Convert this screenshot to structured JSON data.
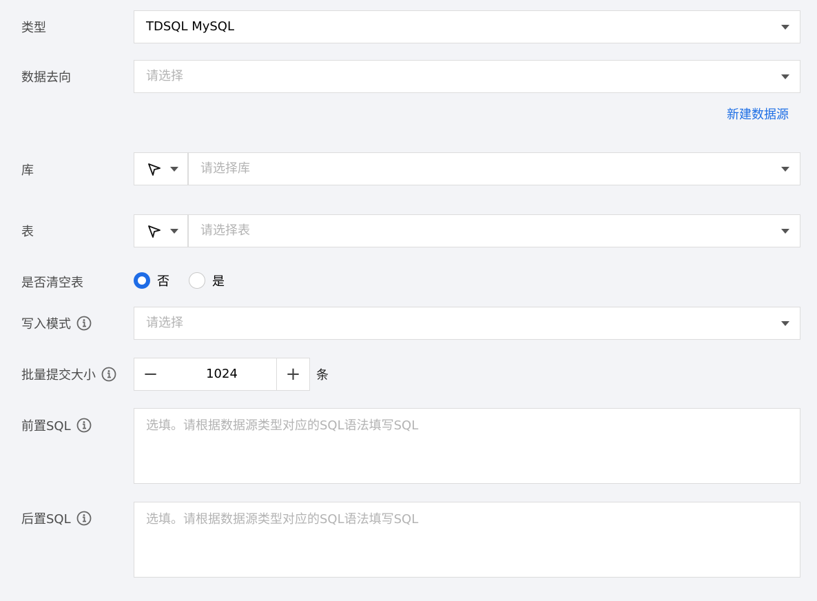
{
  "fields": {
    "type": {
      "label": "类型",
      "value": "TDSQL MySQL"
    },
    "destination": {
      "label": "数据去向",
      "placeholder": "请选择"
    },
    "new_datasource_link": "新建数据源",
    "database": {
      "label": "库",
      "placeholder": "请选择库"
    },
    "table": {
      "label": "表",
      "placeholder": "请选择表"
    },
    "truncate": {
      "label": "是否清空表",
      "options": [
        "否",
        "是"
      ],
      "selected": "否"
    },
    "write_mode": {
      "label": "写入模式",
      "placeholder": "请选择"
    },
    "batch_size": {
      "label": "批量提交大小",
      "value": "1024",
      "unit": "条",
      "minus": "−",
      "plus": "+"
    },
    "pre_sql": {
      "label": "前置SQL",
      "placeholder": "选填。请根据数据源类型对应的SQL语法填写SQL"
    },
    "post_sql": {
      "label": "后置SQL",
      "placeholder": "选填。请根据数据源类型对应的SQL语法填写SQL"
    }
  },
  "icons": {
    "info": "info-circle-icon",
    "picker": "cursor-arrow-icon",
    "dropdown": "chevron-down-icon"
  },
  "colors": {
    "accent": "#1e6ce6",
    "link": "#1f6fe5",
    "background": "#f3f4f7"
  }
}
